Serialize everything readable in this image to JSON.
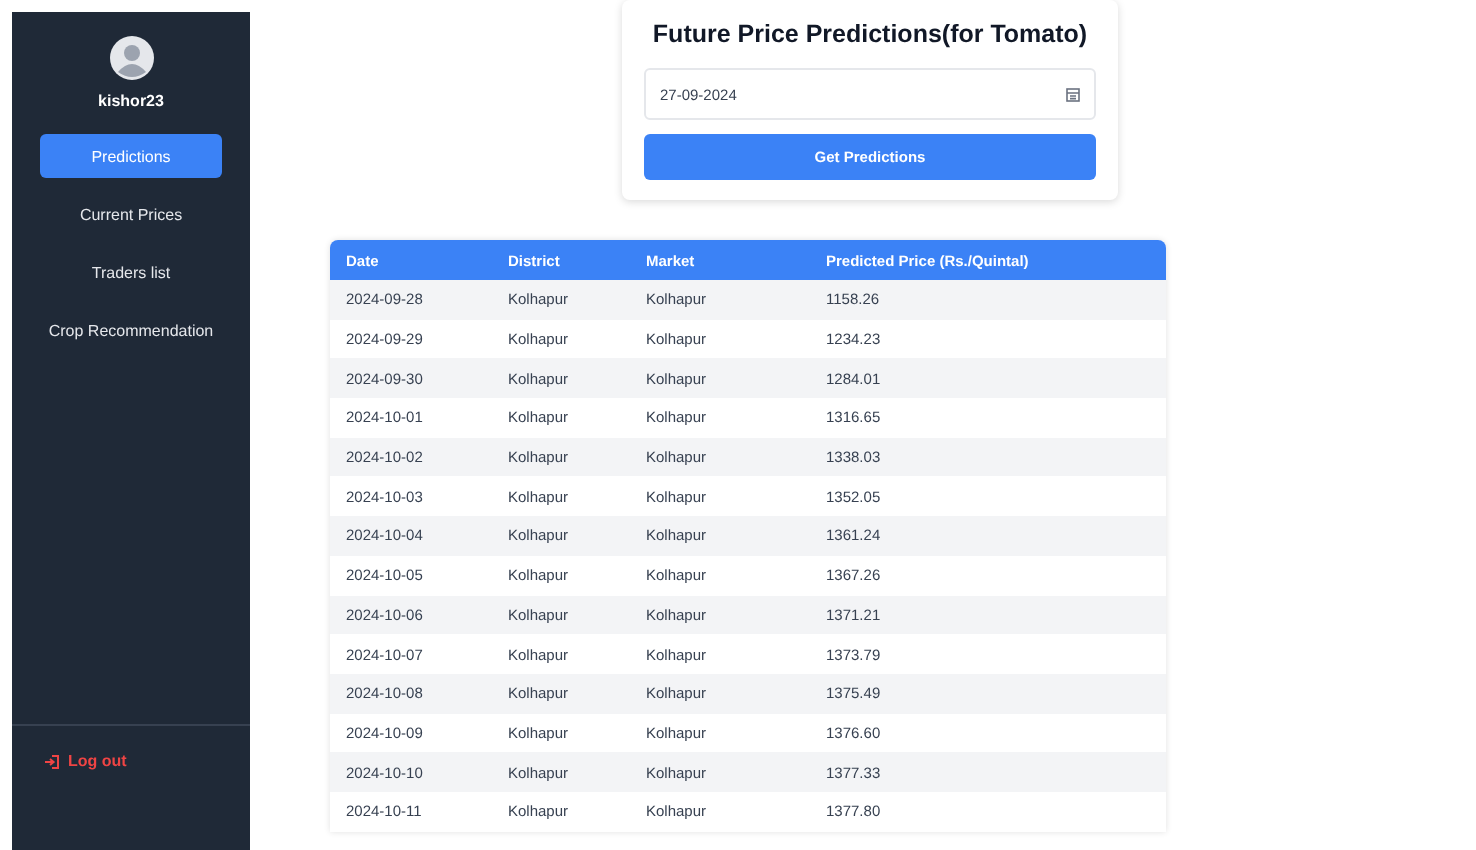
{
  "sidebar": {
    "username": "kishor23",
    "items": [
      {
        "label": "Predictions",
        "selected": true
      },
      {
        "label": "Current Prices",
        "selected": false
      },
      {
        "label": "Traders list",
        "selected": false
      },
      {
        "label": "Crop Recommendation",
        "selected": false
      }
    ],
    "logout": "Log out"
  },
  "card": {
    "title": "Future Price Predictions(for Tomato)",
    "date_value": "27-09-2024",
    "button": "Get Predictions"
  },
  "table": {
    "columns": [
      "Date",
      "District",
      "Market",
      "Predicted Price (Rs./Quintal)"
    ],
    "rows": [
      [
        "2024-09-28",
        "Kolhapur",
        "Kolhapur",
        "1158.26"
      ],
      [
        "2024-09-29",
        "Kolhapur",
        "Kolhapur",
        "1234.23"
      ],
      [
        "2024-09-30",
        "Kolhapur",
        "Kolhapur",
        "1284.01"
      ],
      [
        "2024-10-01",
        "Kolhapur",
        "Kolhapur",
        "1316.65"
      ],
      [
        "2024-10-02",
        "Kolhapur",
        "Kolhapur",
        "1338.03"
      ],
      [
        "2024-10-03",
        "Kolhapur",
        "Kolhapur",
        "1352.05"
      ],
      [
        "2024-10-04",
        "Kolhapur",
        "Kolhapur",
        "1361.24"
      ],
      [
        "2024-10-05",
        "Kolhapur",
        "Kolhapur",
        "1367.26"
      ],
      [
        "2024-10-06",
        "Kolhapur",
        "Kolhapur",
        "1371.21"
      ],
      [
        "2024-10-07",
        "Kolhapur",
        "Kolhapur",
        "1373.79"
      ],
      [
        "2024-10-08",
        "Kolhapur",
        "Kolhapur",
        "1375.49"
      ],
      [
        "2024-10-09",
        "Kolhapur",
        "Kolhapur",
        "1376.60"
      ],
      [
        "2024-10-10",
        "Kolhapur",
        "Kolhapur",
        "1377.33"
      ],
      [
        "2024-10-11",
        "Kolhapur",
        "Kolhapur",
        "1377.80"
      ]
    ]
  }
}
